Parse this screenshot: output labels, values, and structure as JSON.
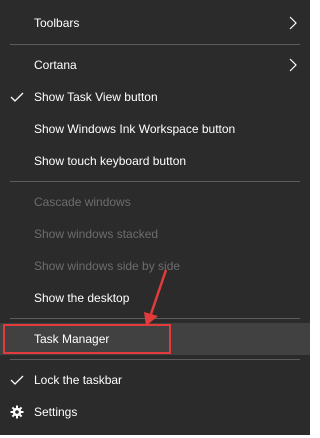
{
  "menu": {
    "items": [
      {
        "label": "Toolbars"
      },
      {
        "label": "Cortana"
      },
      {
        "label": "Show Task View button"
      },
      {
        "label": "Show Windows Ink Workspace button"
      },
      {
        "label": "Show touch keyboard button"
      },
      {
        "label": "Cascade windows"
      },
      {
        "label": "Show windows stacked"
      },
      {
        "label": "Show windows side by side"
      },
      {
        "label": "Show the desktop"
      },
      {
        "label": "Task Manager"
      },
      {
        "label": "Lock the taskbar"
      },
      {
        "label": "Settings"
      }
    ]
  },
  "colors": {
    "menu_bg": "#2b2b2b",
    "text": "#ffffff",
    "disabled_text": "#6d6d6d",
    "highlight_bg": "#414141",
    "separator": "#5c5c5c",
    "annotation": "#e33b3b"
  },
  "icons": {
    "submenu": "chevron-right-icon",
    "checked": "checkmark-icon",
    "settings": "gear-icon"
  }
}
